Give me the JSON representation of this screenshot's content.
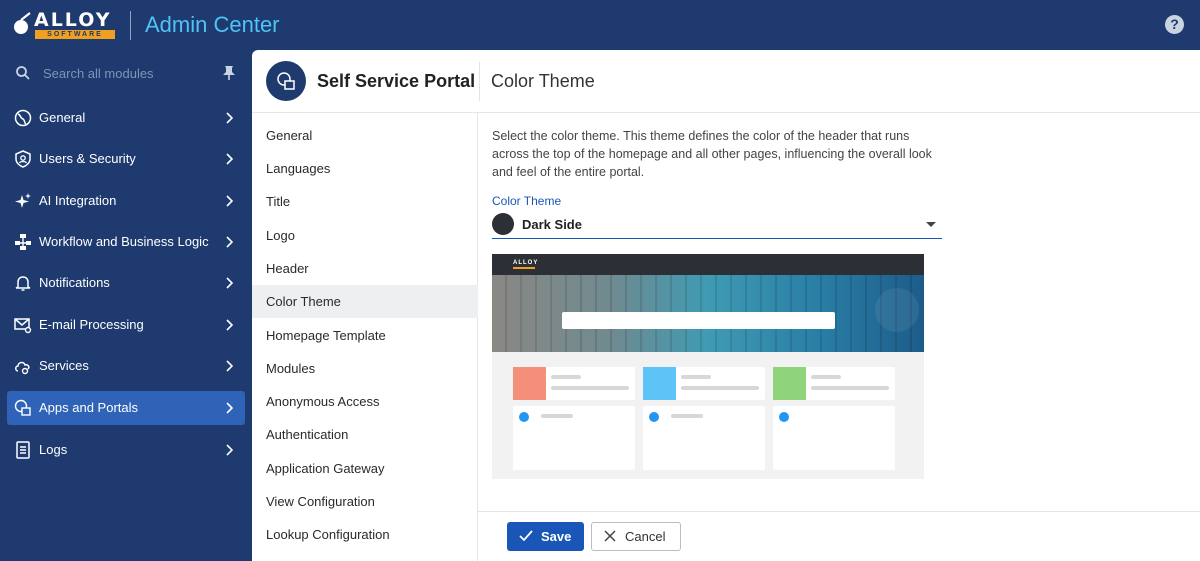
{
  "brand": {
    "logo_word": "ALLOY",
    "logo_sub": "SOFTWARE",
    "app_title": "Admin Center",
    "help_icon": "help-icon",
    "help_glyph": "?"
  },
  "sidebar": {
    "search_placeholder": "Search all modules",
    "items": [
      {
        "label": "General",
        "icon": "globe-icon"
      },
      {
        "label": "Users & Security",
        "icon": "shield-user-icon"
      },
      {
        "label": "AI Integration",
        "icon": "sparkle-icon"
      },
      {
        "label": "Workflow and Business Logic",
        "icon": "workflow-icon"
      },
      {
        "label": "Notifications",
        "icon": "bell-icon"
      },
      {
        "label": "E-mail Processing",
        "icon": "mail-gear-icon"
      },
      {
        "label": "Services",
        "icon": "cloud-gear-icon"
      },
      {
        "label": "Apps and Portals",
        "icon": "apps-portal-icon",
        "active": true
      },
      {
        "label": "Logs",
        "icon": "log-icon"
      }
    ]
  },
  "header": {
    "portal_name": "Self Service Portal",
    "section_title": "Color Theme"
  },
  "subnav": {
    "items": [
      {
        "label": "General"
      },
      {
        "label": "Languages"
      },
      {
        "label": "Title"
      },
      {
        "label": "Logo"
      },
      {
        "label": "Header"
      },
      {
        "label": "Color Theme",
        "active": true
      },
      {
        "label": "Homepage Template"
      },
      {
        "label": "Modules"
      },
      {
        "label": "Anonymous Access"
      },
      {
        "label": "Authentication"
      },
      {
        "label": "Application Gateway"
      },
      {
        "label": "View Configuration"
      },
      {
        "label": "Lookup Configuration"
      }
    ]
  },
  "content": {
    "description": "Select the color theme. This theme defines the color of the header that runs across the top of the homepage and all other pages, influencing the overall look and feel of the entire portal.",
    "field_label": "Color Theme",
    "selected_theme": "Dark Side",
    "selected_theme_color": "#2d2f36",
    "preview": {
      "logo_word": "ALLOY",
      "card_colors": [
        "#f4907a",
        "#5ec3f7",
        "#8fd47a"
      ],
      "dot_color": "#2196f3"
    }
  },
  "footer": {
    "save_label": "Save",
    "cancel_label": "Cancel"
  },
  "colors": {
    "nav_bg": "#1e3a6e",
    "active": "#2f63b8",
    "accent": "#1a56b8",
    "title_blue": "#4fc3f7"
  }
}
